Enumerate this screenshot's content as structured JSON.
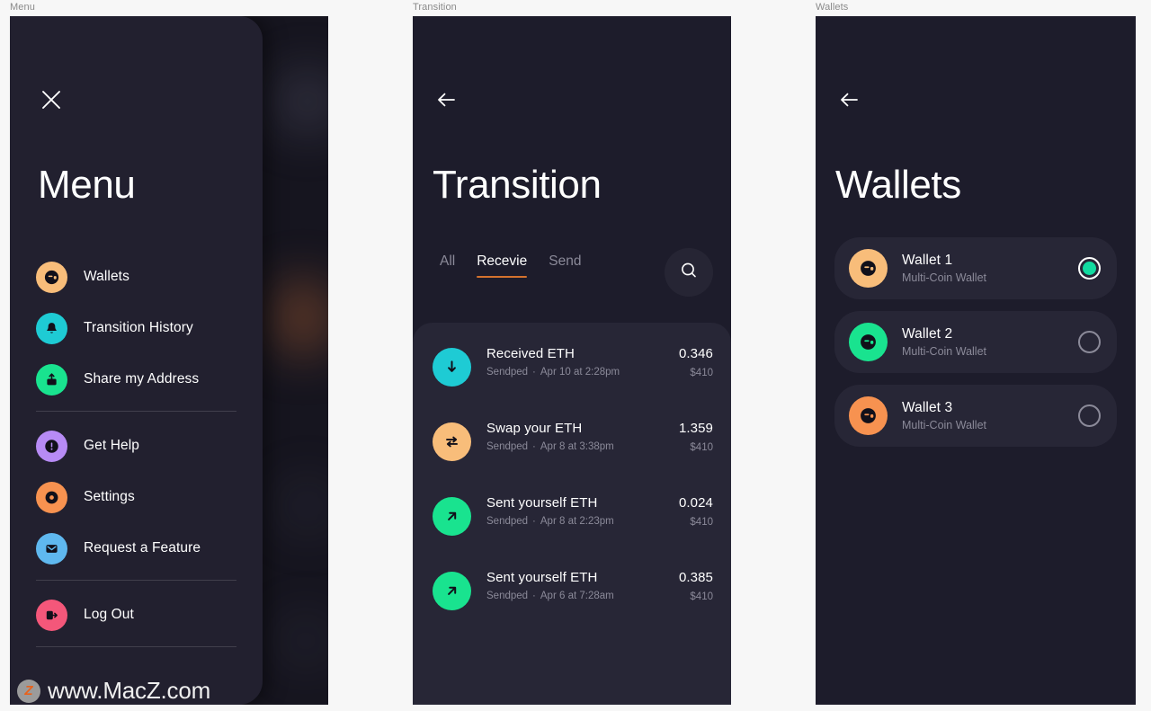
{
  "frames": [
    {
      "label": "Menu"
    },
    {
      "label": "Transition"
    },
    {
      "label": "Wallets"
    }
  ],
  "menu_screen": {
    "title": "Menu",
    "close_icon": "close-icon",
    "groups": [
      {
        "items": [
          {
            "label": "Wallets",
            "icon": "wallet-icon",
            "color": "#f8bd7a"
          },
          {
            "label": "Transition History",
            "icon": "bell-icon",
            "color": "#1ecbd4"
          },
          {
            "label": "Share my Address",
            "icon": "share-upload-icon",
            "color": "#19e38f"
          }
        ]
      },
      {
        "items": [
          {
            "label": "Get Help",
            "icon": "exclamation-icon",
            "color": "#b78bf5"
          },
          {
            "label": "Settings",
            "icon": "gear-dot-icon",
            "color": "#f79250"
          },
          {
            "label": "Request a Feature",
            "icon": "envelope-icon",
            "color": "#5fb8ef"
          }
        ]
      },
      {
        "items": [
          {
            "label": "Log Out",
            "icon": "logout-icon",
            "color": "#f4577a"
          }
        ]
      }
    ],
    "watermark": {
      "logo_letter": "Z",
      "text": "www.MacZ.com"
    }
  },
  "transition_screen": {
    "title": "Transition",
    "back_icon": "arrow-left-icon",
    "search_icon": "search-icon",
    "tabs": [
      {
        "label": "All",
        "active": false
      },
      {
        "label": "Recevie",
        "active": true
      },
      {
        "label": "Send",
        "active": false
      }
    ],
    "accent_color": "#d4722e",
    "transactions": [
      {
        "title": "Received ETH",
        "status": "Sendped",
        "separator": "·",
        "date": "Apr 10 at 2:28pm",
        "amount": "0.346",
        "fiat": "$410",
        "icon": "arrow-down-icon",
        "color": "#1ecbd4"
      },
      {
        "title": "Swap your ETH",
        "status": "Sendped",
        "separator": "·",
        "date": "Apr 8 at 3:38pm",
        "amount": "1.359",
        "fiat": "$410",
        "icon": "swap-icon",
        "color": "#f8bd7a"
      },
      {
        "title": "Sent yourself ETH",
        "status": "Sendped",
        "separator": "·",
        "date": "Apr 8 at 2:23pm",
        "amount": "0.024",
        "fiat": "$410",
        "icon": "arrow-upright-icon",
        "color": "#19e38f"
      },
      {
        "title": "Sent yourself ETH",
        "status": "Sendped",
        "separator": "·",
        "date": "Apr 6 at 7:28am",
        "amount": "0.385",
        "fiat": "$410",
        "icon": "arrow-upright-icon",
        "color": "#19e38f"
      }
    ]
  },
  "wallets_screen": {
    "title": "Wallets",
    "back_icon": "arrow-left-icon",
    "wallets": [
      {
        "name": "Wallet 1",
        "type": "Multi-Coin Wallet",
        "selected": true,
        "icon": "wallet-icon",
        "color": "#f8bd7a",
        "selected_color": "#12dba0"
      },
      {
        "name": "Wallet 2",
        "type": "Multi-Coin Wallet",
        "selected": false,
        "icon": "wallet-icon",
        "color": "#19e38f"
      },
      {
        "name": "Wallet 3",
        "type": "Multi-Coin Wallet",
        "selected": false,
        "icon": "wallet-icon",
        "color": "#f79250"
      }
    ]
  }
}
